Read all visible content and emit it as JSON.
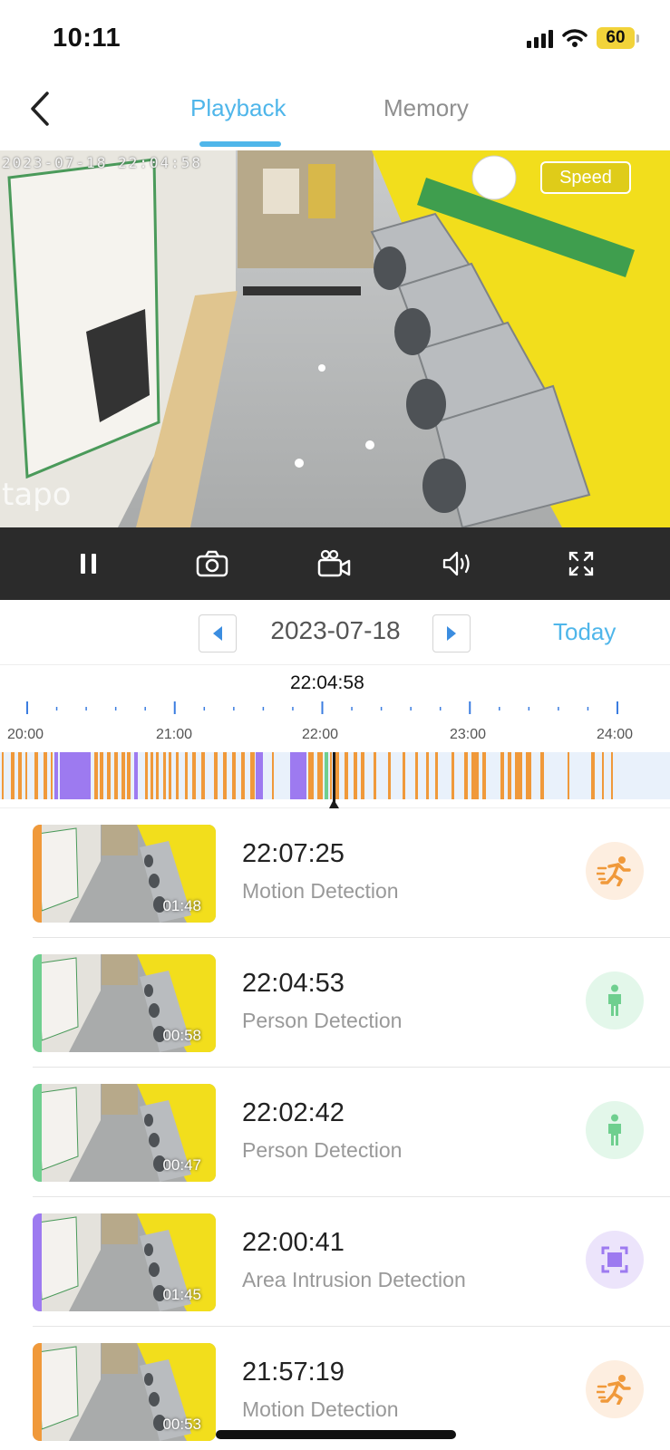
{
  "status_bar": {
    "time": "10:11",
    "battery": "60"
  },
  "header": {
    "tabs": [
      {
        "label": "Playback",
        "active": true
      },
      {
        "label": "Memory",
        "active": false
      }
    ],
    "back_icon": "chevron-left-icon"
  },
  "video": {
    "osd_timestamp": "2023-07-18  22:04:58",
    "speed_label": "Speed",
    "watermark": "tapo"
  },
  "controls": [
    {
      "name": "pause-button",
      "icon": "pause-icon"
    },
    {
      "name": "snapshot-button",
      "icon": "camera-icon"
    },
    {
      "name": "record-clip-button",
      "icon": "video-camera-icon"
    },
    {
      "name": "volume-button",
      "icon": "speaker-icon"
    },
    {
      "name": "fullscreen-button",
      "icon": "expand-icon"
    }
  ],
  "date_selector": {
    "date": "2023-07-18",
    "today_label": "Today"
  },
  "timeline": {
    "cursor_time": "22:04:58",
    "hour_labels": [
      "20:00",
      "21:00",
      "22:00",
      "23:00",
      "24:00"
    ],
    "colors": {
      "motion": "#f0993a",
      "person": "#6fcf8f",
      "area": "#9d7af0",
      "bg": "#e9f1fb"
    }
  },
  "recordings": [
    {
      "time": "22:07:25",
      "type": "Motion Detection",
      "duration": "01:48",
      "color": "#f0993a",
      "icon": "running-person-icon",
      "icon_bg": "#fdeee0"
    },
    {
      "time": "22:04:53",
      "type": "Person Detection",
      "duration": "00:58",
      "color": "#6fcf8f",
      "icon": "person-icon",
      "icon_bg": "#e3f7ea"
    },
    {
      "time": "22:02:42",
      "type": "Person Detection",
      "duration": "00:47",
      "color": "#6fcf8f",
      "icon": "person-icon",
      "icon_bg": "#e3f7ea"
    },
    {
      "time": "22:00:41",
      "type": "Area Intrusion Detection",
      "duration": "01:45",
      "color": "#9d7af0",
      "icon": "area-intrusion-icon",
      "icon_bg": "#ece4fb"
    },
    {
      "time": "21:57:19",
      "type": "Motion Detection",
      "duration": "00:53",
      "color": "#f0993a",
      "icon": "running-person-icon",
      "icon_bg": "#fdeee0"
    }
  ]
}
